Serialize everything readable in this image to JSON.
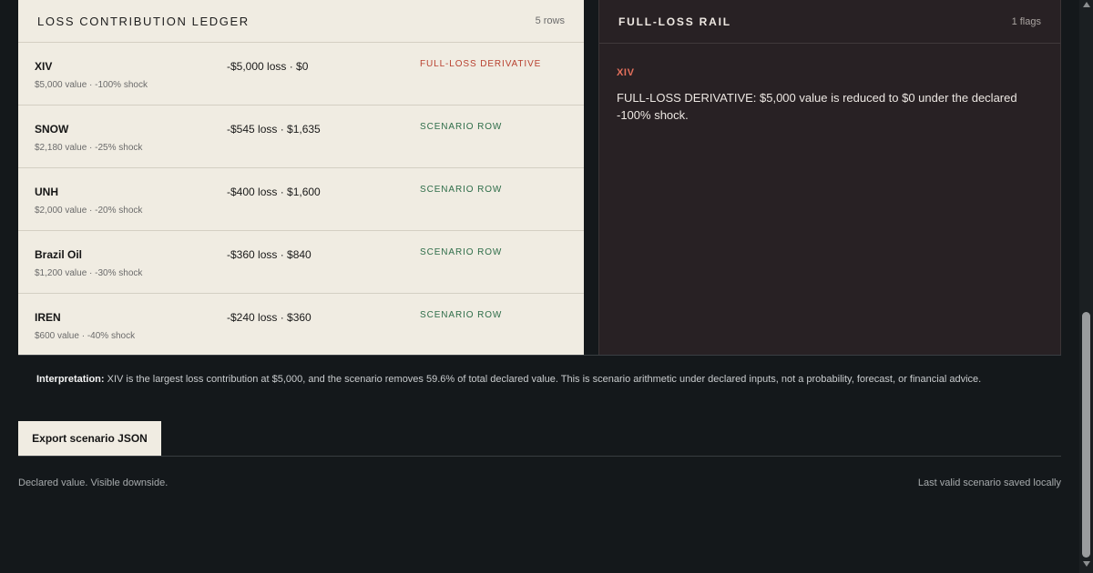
{
  "ledger": {
    "title": "LOSS CONTRIBUTION LEDGER",
    "count": "5 rows",
    "rows": [
      {
        "name": "XIV",
        "sub": "$5,000 value · -100% shock",
        "loss": "-$5,000 loss · $0",
        "tag": "FULL-LOSS DERIVATIVE",
        "tag_status": "red"
      },
      {
        "name": "SNOW",
        "sub": "$2,180 value · -25% shock",
        "loss": "-$545 loss · $1,635",
        "tag": "SCENARIO ROW",
        "tag_status": "green"
      },
      {
        "name": "UNH",
        "sub": "$2,000 value · -20% shock",
        "loss": "-$400 loss · $1,600",
        "tag": "SCENARIO ROW",
        "tag_status": "green"
      },
      {
        "name": "Brazil Oil",
        "sub": "$1,200 value · -30% shock",
        "loss": "-$360 loss · $840",
        "tag": "SCENARIO ROW",
        "tag_status": "green"
      },
      {
        "name": "IREN",
        "sub": "$600 value · -40% shock",
        "loss": "-$240 loss · $360",
        "tag": "SCENARIO ROW",
        "tag_status": "green"
      }
    ]
  },
  "rail": {
    "title": "FULL-LOSS RAIL",
    "count": "1 flags",
    "flag_name": "XIV",
    "flag_text": "FULL-LOSS DERIVATIVE: $5,000 value is reduced to $0 under the declared -100% shock."
  },
  "interpretation": {
    "label": "Interpretation:",
    "text": " XIV is the largest loss contribution at $5,000, and the scenario removes 59.6% of total declared value. This is scenario arithmetic under declared inputs, not a probability, forecast, or financial advice."
  },
  "export_label": "Export scenario JSON",
  "footer": {
    "left": "Declared value. Visible downside.",
    "right": "Last valid scenario saved locally"
  },
  "colors": {
    "ledger_bg": "#f0ece2",
    "rail_bg": "#282124",
    "page_bg": "#14181b",
    "tag_red": "#b8402f",
    "tag_green": "#2e6d49",
    "flag_accent": "#e5705c"
  }
}
